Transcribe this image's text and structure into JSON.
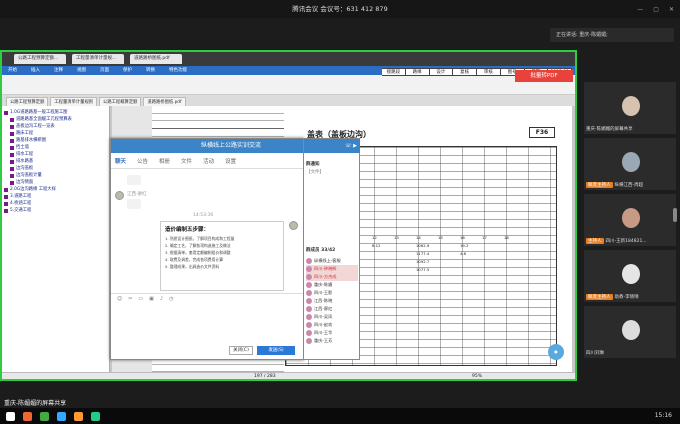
{
  "meeting": {
    "title": "腾讯会议 会议号：631 412 879",
    "speaking": "正在讲话: 重庆-陈媚媚;",
    "share_label": "重庆-陈媚媚的屏幕共享",
    "clock": "15:16"
  },
  "pdf": {
    "tabs": [
      "公路工程预算定额...",
      "工程量清单计量规...",
      "道路路桥图纸.pdf"
    ],
    "menu": [
      "开始",
      "插入",
      "注释",
      "视图",
      "页面",
      "保护",
      "转换",
      "特色功能"
    ],
    "doc_tabs": [
      "公路工程预算定额",
      "工程量清单计量规则",
      "公路工程概算定额",
      "道路路桥图纸.pdf"
    ],
    "convert_button": "批量转PDF",
    "title_strip": [
      "接路段",
      "路缘",
      "设计",
      "复核",
      "审核",
      "图号",
      "日期",
      "2013.09"
    ],
    "table_title": "盖表（盖板边沟）",
    "table_code": "F36",
    "page_indicator": "197 / 283",
    "zoom": "95%",
    "tree": [
      "1.0G道路路基一般工程施工图",
      "道路路基全面缓工元程预算表",
      "盖板边沟工程一览表",
      "路床工程",
      "路基排水横断图",
      "挡土墙",
      "排水工程",
      "排水路基",
      "边沟盖板",
      "边沟盖板计量",
      "边沟侧面",
      "2.0G边沟路缘 工程大样",
      "3.道路工程",
      "4.桥涵工程",
      "5.交通工程"
    ],
    "grid_values": [
      "9",
      "10",
      "11",
      "12",
      "13",
      "14",
      "15",
      "16",
      "17",
      "18",
      "8.12",
      "1062.9",
      "1177.4",
      "19.2",
      "1092.7",
      "4.6",
      "1077.5"
    ]
  },
  "chat": {
    "header": "纵横线上公路实训交流",
    "tabs": [
      "聊天",
      "公告",
      "相册",
      "文件",
      "活动",
      "设置"
    ],
    "sender": "江西-廖红",
    "timestamp": "14:53:36",
    "card_title": "造价编制五步骤：",
    "card_lines": [
      "1. 熟悉设计图纸，了解项目构成和工程量",
      "2. 确定工艺，了解各项构造施工及做法",
      "3. 根据清单，套用定额编制组价和调整",
      "4. 取费及调差，完成各项费用计算",
      "5. 整理成果，出具造价文件资料"
    ],
    "close_button": "关闭(C)",
    "send_button": "发送(S)",
    "group_note_label": "群通知",
    "group_file": "【文件】",
    "members_label": "群成员 33/42",
    "members": [
      "纵横线上-客服",
      "四川-钟晓辉",
      "四川-方杰成",
      "重庆-陈媚",
      "四川-王影",
      "江西-陈晓",
      "江西-廖红",
      "四川-吴凤",
      "四川-赵欢",
      "四川-王华",
      "重庆-王芳"
    ]
  },
  "participants": [
    {
      "name": "重庆-陈媚媚的屏幕共享",
      "host": ""
    },
    {
      "name": "纵横江西-周超",
      "host": "联席主持人"
    },
    {
      "name": "四川-王新184821...",
      "host": "主持人"
    },
    {
      "name": "助教-李晓晴",
      "host": "联席主持人"
    },
    {
      "name": "四川刘琳",
      "host": ""
    }
  ],
  "colors": {
    "accent": "#2b6cc4",
    "share_border": "#2ecc40",
    "convert": "#e8423a",
    "host_badge": "#e67e22"
  }
}
